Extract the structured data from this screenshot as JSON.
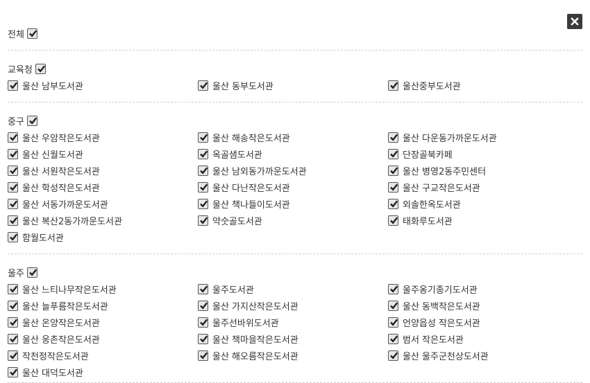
{
  "close_icon": "close-icon",
  "all": {
    "label": "전체",
    "checked": true
  },
  "groups": [
    {
      "label": "교육청",
      "checked": true,
      "items": [
        "울산 남부도서관",
        "울산 동부도서관",
        "울산중부도서관"
      ]
    },
    {
      "label": "중구",
      "checked": true,
      "items": [
        "울산 우암작은도서관",
        "울산 해송작은도서관",
        "울산 다운동가까운도서관",
        "울산 신월도서관",
        "옥골샘도서관",
        "단장골북카페",
        "울산 서원작은도서관",
        "울산 남외동가까운도서관",
        "울산 병영2동주민센터",
        "울산 학성작은도서관",
        "울산 다난작은도서관",
        "울산 구교작은도서관",
        "울산 서동가까운도서관",
        "울산 책나들이도서관",
        "외솔한옥도서관",
        "울산 복산2동가까운도서관",
        "약숫골도서관",
        "태화루도서관",
        "함월도서관"
      ]
    },
    {
      "label": "울주",
      "checked": true,
      "items": [
        "울산 느티나무작은도서관",
        "울주도서관",
        "울주옹기종기도서관",
        "울산 늘푸름작은도서관",
        "울산 가지산작은도서관",
        "울산 동백작은도서관",
        "울산 온양작은도서관",
        "울주선바위도서관",
        "언양읍성 작은도서관",
        "울산 웅촌작은도서관",
        "울산 책마을작은도서관",
        "범서 작은도서관",
        "작천정작은도서관",
        "울산 해오름작은도서관",
        "울산 울주군천상도서관",
        "울산 대덕도서관"
      ]
    }
  ]
}
